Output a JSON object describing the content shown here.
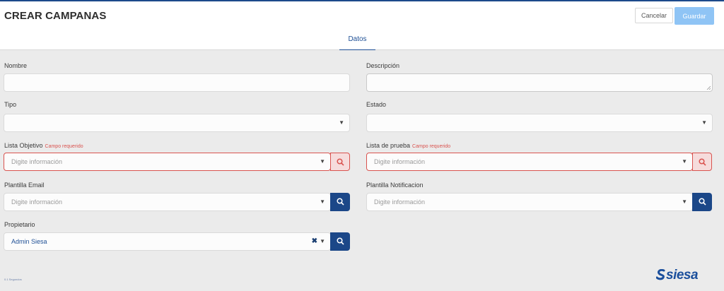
{
  "header": {
    "title": "CREAR CAMPANAS",
    "cancel_label": "Cancelar",
    "save_label": "Guardar"
  },
  "tabs": [
    {
      "label": "Datos",
      "active": true
    }
  ],
  "form": {
    "nombre_label": "Nombre",
    "descripcion_label": "Descripción",
    "tipo_label": "Tipo",
    "estado_label": "Estado",
    "lista_objetivo_label": "Lista Objetivo",
    "lista_objetivo_required": "Campo requerido",
    "lista_objetivo_placeholder": "Digite información",
    "lista_prueba_label": "Lista de prueba",
    "lista_prueba_required": "Campo requerido",
    "lista_prueba_placeholder": "Digite información",
    "plantilla_email_label": "Plantilla Email",
    "plantilla_email_placeholder": "Digite información",
    "plantilla_notificacion_label": "Plantilla Notificacion",
    "plantilla_notificacion_placeholder": "Digite información",
    "propietario_label": "Propietario",
    "propietario_value": "Admin Siesa"
  },
  "footer": {
    "timer_text": "0.1 Segundos",
    "logo_text": "siesa"
  },
  "colors": {
    "accent": "#1b4788",
    "error": "#d9534f",
    "save_button": "#8fc4f5"
  }
}
